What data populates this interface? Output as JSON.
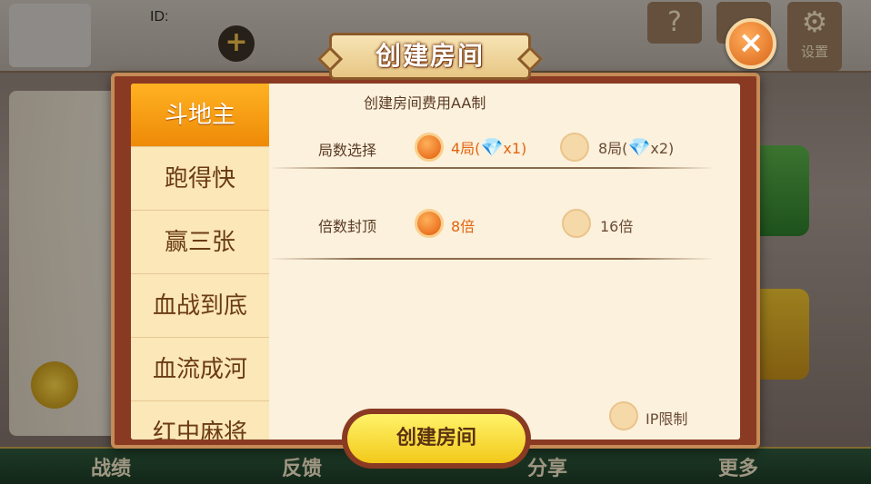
{
  "header": {
    "id_label": "ID:",
    "settings_label": "设置"
  },
  "bottom_nav": [
    "战绩",
    "反馈",
    "分享",
    "更多"
  ],
  "dialog": {
    "title": "创建房间",
    "close_glyph": "×",
    "tabs": [
      {
        "label": "斗地主",
        "active": true
      },
      {
        "label": "跑得快",
        "active": false
      },
      {
        "label": "赢三张",
        "active": false
      },
      {
        "label": "血战到底",
        "active": false
      },
      {
        "label": "血流成河",
        "active": false
      },
      {
        "label": "红中麻将",
        "active": false
      }
    ],
    "subtitle": "创建房间费用AA制",
    "rounds": {
      "label": "局数选择",
      "options": [
        {
          "text": "4局(",
          "suffix": "x1)",
          "selected": true
        },
        {
          "text": "8局(",
          "suffix": "x2)",
          "selected": false
        }
      ]
    },
    "multiplier": {
      "label": "倍数封顶",
      "options": [
        {
          "text": "8倍",
          "selected": true
        },
        {
          "text": "16倍",
          "selected": false
        }
      ]
    },
    "ip_limit_label": "IP限制",
    "create_button_label": "创建房间"
  },
  "icons": {
    "gem": "diamond-icon",
    "close": "close-icon",
    "settings": "gear-icon"
  }
}
